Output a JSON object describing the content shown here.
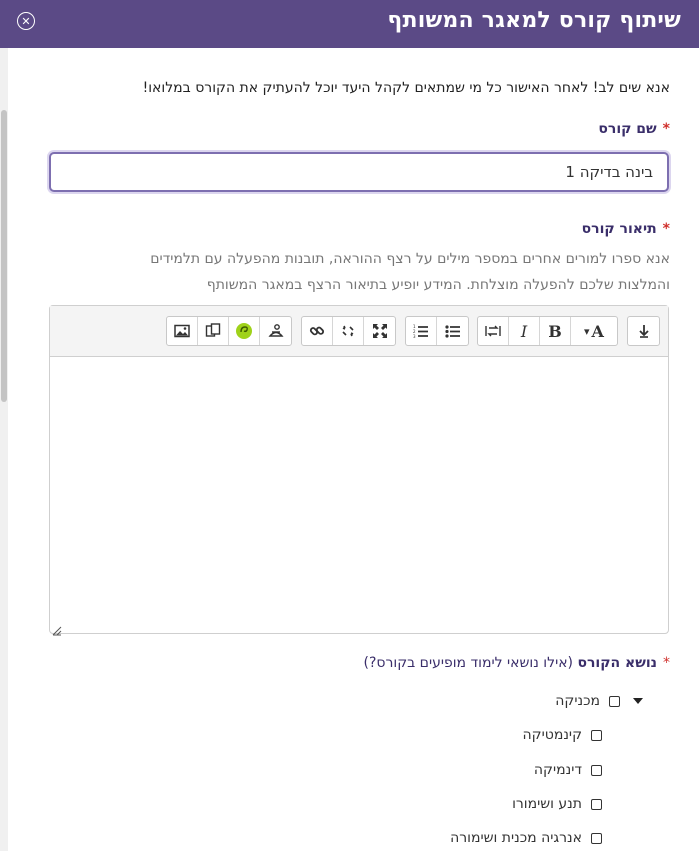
{
  "header": {
    "title": "שיתוף קורס למאגר המשותף",
    "close_glyph": "✕"
  },
  "notice": "אנא שים לב! לאחר האישור כל מי שמתאים לקהל היעד יוכל להעתיק את הקורס במלואו!",
  "course_name": {
    "required_mark": "*",
    "label": "שם קורס",
    "value": "בינה בדיקה 1"
  },
  "course_description": {
    "required_mark": "*",
    "label": "תיאור קורס",
    "help_line1": "אנא ספרו למורים אחרים במספר מילים על רצף ההוראה, תובנות מהפעלה עם תלמידים",
    "help_line2": "והמלצות שלכם להפעלה מוצלחת. המידע יופיע בתיאור הרצף במאגר המשותף"
  },
  "toolbar": {
    "bold": "B",
    "italic": "I",
    "font_style": "A",
    "dropdown": "▾",
    "collapse_glyph": "↧",
    "icons": [
      "collapse-icon",
      "font-style-icon",
      "bold-icon",
      "italic-icon",
      "text-direction-icon",
      "bullet-list-icon",
      "numbered-list-icon",
      "link-icon",
      "unlink-icon",
      "fullscreen-icon",
      "image-icon",
      "copy-icon",
      "h5p-icon",
      "accessibility-checker-icon"
    ]
  },
  "course_topic": {
    "required_mark": "*",
    "label": "נושא הקורס",
    "hint": "(אילו נושאי לימוד מופיעים בקורס?)",
    "items": [
      {
        "label": "מכניקה",
        "checked": false,
        "expanded": true
      },
      {
        "label": "קינמטיקה",
        "checked": false
      },
      {
        "label": "דינמיקה",
        "checked": false
      },
      {
        "label": "תנע ושימורו",
        "checked": false
      },
      {
        "label": "אנרגיה מכנית ושימורה",
        "checked": false
      }
    ]
  },
  "colors": {
    "header_bg": "#5b4a86",
    "label": "#3a2e6a",
    "required": "#d0312d",
    "focus_border": "#7d6fb0"
  }
}
